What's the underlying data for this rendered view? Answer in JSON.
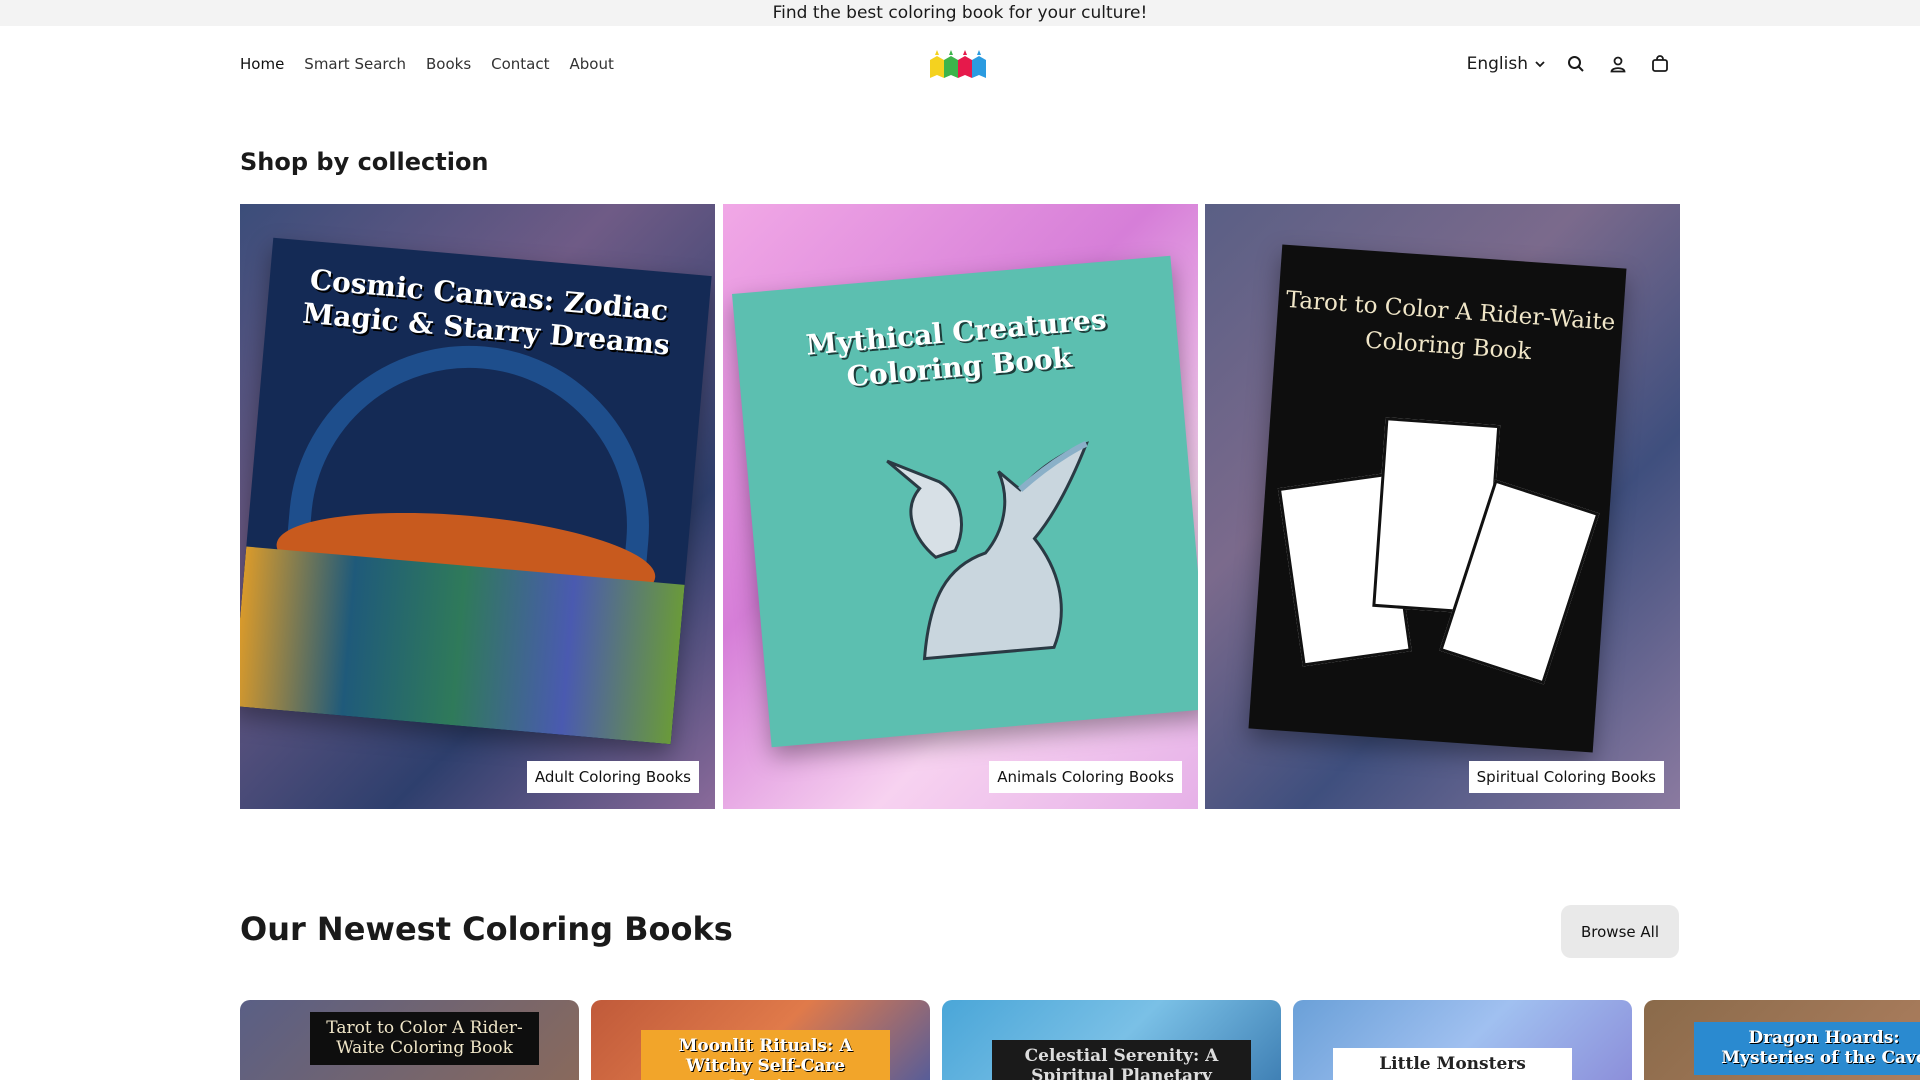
{
  "announcement": {
    "text": "Find the best coloring book for your culture!"
  },
  "nav": {
    "items": [
      {
        "label": "Home"
      },
      {
        "label": "Smart Search"
      },
      {
        "label": "Books"
      },
      {
        "label": "Contact"
      },
      {
        "label": "About"
      }
    ]
  },
  "header": {
    "language": "English",
    "icons": [
      "search-icon",
      "account-icon",
      "cart-icon"
    ]
  },
  "collections": {
    "title": "Shop by collection",
    "items": [
      {
        "label": "Adult Coloring Books",
        "cover_title": "Cosmic Canvas: Zodiac Magic & Starry Dreams"
      },
      {
        "label": "Animals Coloring Books",
        "cover_title": "Mythical Creatures Coloring Book"
      },
      {
        "label": "Spiritual Coloring Books",
        "cover_title": "Tarot to Color A Rider-Waite Coloring Book"
      }
    ]
  },
  "newest": {
    "title": "Our Newest Coloring Books",
    "browse_label": "Browse All",
    "books": [
      {
        "cover_title": "Tarot to Color A Rider-Waite Coloring Book"
      },
      {
        "cover_title": "Moonlit Rituals: A Witchy Self-Care Coloring"
      },
      {
        "cover_title": "Celestial Serenity: A Spiritual Planetary"
      },
      {
        "cover_title": "Little Monsters"
      },
      {
        "cover_title": "Dragon Hoards: Mysteries of the Cave"
      }
    ]
  },
  "colors": {
    "announcement_bg": "#f3f3f3",
    "browse_button_bg": "#e9e9e9",
    "logo_colors": [
      "#f4d21f",
      "#3cb44b",
      "#e6194b",
      "#2b9be0"
    ]
  }
}
